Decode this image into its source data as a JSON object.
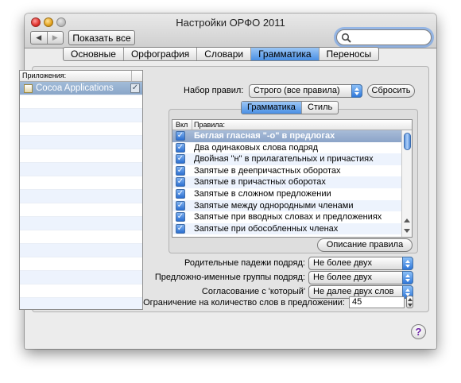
{
  "window": {
    "title": "Настройки ОРФО 2011"
  },
  "toolbar": {
    "back_glyph": "◀",
    "forward_glyph": "▶",
    "show_all_label": "Показать все",
    "search_value": ""
  },
  "tabs": [
    {
      "label": "Основные",
      "active": false
    },
    {
      "label": "Орфография",
      "active": false
    },
    {
      "label": "Словари",
      "active": false
    },
    {
      "label": "Грамматика",
      "active": true
    },
    {
      "label": "Переносы",
      "active": false
    }
  ],
  "apps": {
    "header": "Приложения:",
    "items": [
      {
        "label": "Cocoa Applications",
        "checked": true
      }
    ]
  },
  "ruleset": {
    "label": "Набор правил:",
    "value": "Строго (все правила)",
    "reset_label": "Сбросить"
  },
  "subtabs": [
    {
      "label": "Грамматика",
      "active": true
    },
    {
      "label": "Стиль",
      "active": false
    }
  ],
  "rules_table": {
    "col_enabled": "Вкл",
    "col_rules": "Правила:",
    "rows": [
      {
        "label": "Беглая гласная \"-о\" в предлогах",
        "checked": true,
        "selected": true
      },
      {
        "label": "Два одинаковых слова подряд",
        "checked": true
      },
      {
        "label": "Двойная \"н\" в прилагательных и причастиях",
        "checked": true
      },
      {
        "label": "Запятые в деепричастных оборотах",
        "checked": true
      },
      {
        "label": "Запятые в причастных оборотах",
        "checked": true
      },
      {
        "label": "Запятые в сложном предложении",
        "checked": true
      },
      {
        "label": "Запятые между однородными членами",
        "checked": true
      },
      {
        "label": "Запятые при вводных словах и предложениях",
        "checked": true
      },
      {
        "label": "Запятые при обособленных членах",
        "checked": true
      }
    ]
  },
  "rule_description_label": "Описание правила",
  "settings": {
    "genitive": {
      "label": "Родительные падежи подряд:",
      "value": "Не более двух"
    },
    "prepositional": {
      "label": "Предложно-именные группы подряд:",
      "value": "Не более двух"
    },
    "agreement": {
      "label": "Согласование с 'который'",
      "value": "Не далее двух слов"
    },
    "word_limit": {
      "label": "Ограничение на количество слов в предложении:",
      "value": "45"
    }
  },
  "help_glyph": "?"
}
